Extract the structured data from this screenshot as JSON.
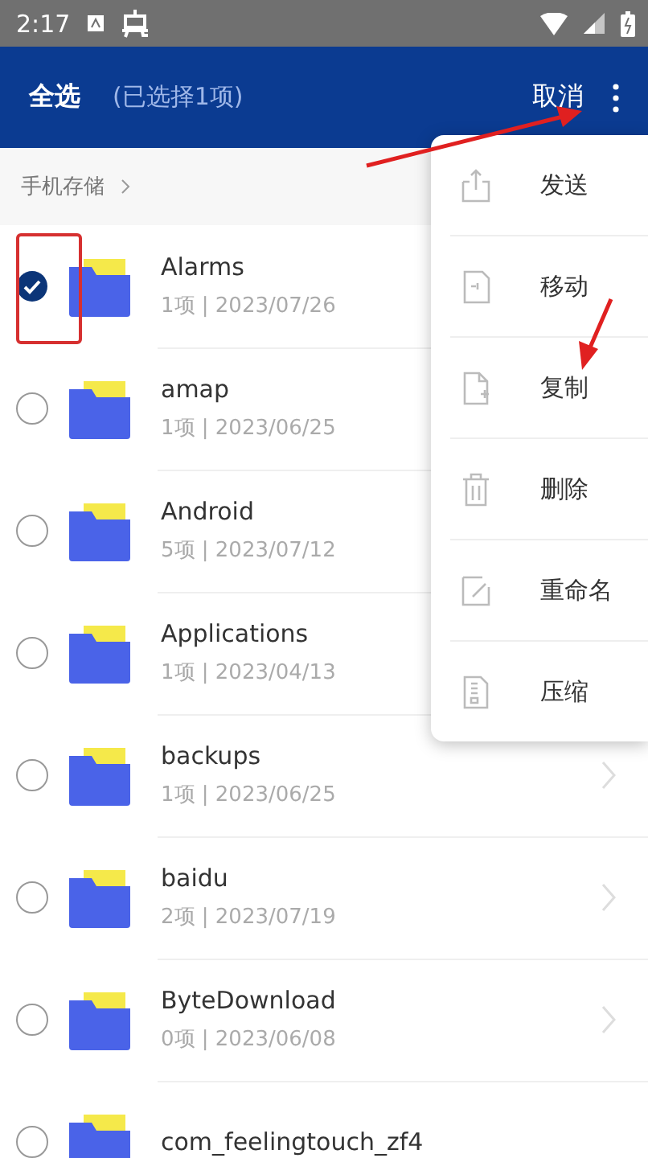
{
  "status_bar": {
    "time": "2:17"
  },
  "app_bar": {
    "select_all": "全选",
    "selection_count": "(已选择1项)",
    "cancel": "取消"
  },
  "breadcrumb": {
    "label": "手机存储"
  },
  "files": [
    {
      "name": "Alarms",
      "meta": "1项 | 2023/07/26",
      "selected": true
    },
    {
      "name": "amap",
      "meta": "1项 | 2023/06/25",
      "selected": false
    },
    {
      "name": "Android",
      "meta": "5项 | 2023/07/12",
      "selected": false
    },
    {
      "name": "Applications",
      "meta": "1项 | 2023/04/13",
      "selected": false
    },
    {
      "name": "backups",
      "meta": "1项 | 2023/06/25",
      "selected": false,
      "chevron": true
    },
    {
      "name": "baidu",
      "meta": "2项 | 2023/07/19",
      "selected": false,
      "chevron": true
    },
    {
      "name": "ByteDownload",
      "meta": "0项 | 2023/06/08",
      "selected": false,
      "chevron": true
    },
    {
      "name": "com_feelingtouch_zf4",
      "selected": false
    }
  ],
  "menu": {
    "items": [
      {
        "label": "发送",
        "kind": "send"
      },
      {
        "label": "移动",
        "kind": "move"
      },
      {
        "label": "复制",
        "kind": "copy"
      },
      {
        "label": "删除",
        "kind": "delete"
      },
      {
        "label": "重命名",
        "kind": "rename"
      },
      {
        "label": "压缩",
        "kind": "compress"
      }
    ]
  }
}
